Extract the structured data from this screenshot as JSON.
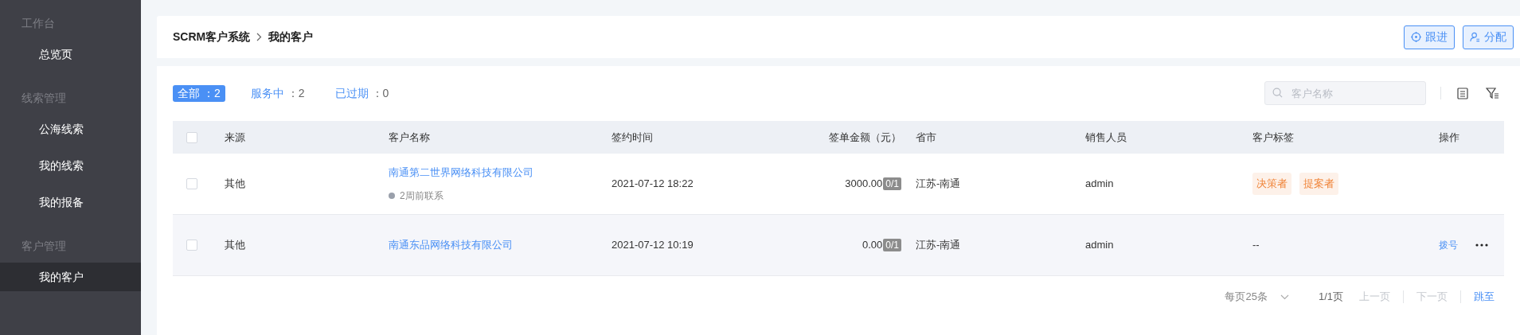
{
  "sidebar": {
    "groups": [
      {
        "title": "工作台",
        "items": [
          {
            "label": "总览页",
            "selected": false
          }
        ]
      },
      {
        "title": "线索管理",
        "items": [
          {
            "label": "公海线索",
            "selected": false
          },
          {
            "label": "我的线索",
            "selected": false
          },
          {
            "label": "我的报备",
            "selected": false
          }
        ]
      },
      {
        "title": "客户管理",
        "items": [
          {
            "label": "我的客户",
            "selected": true
          }
        ]
      }
    ]
  },
  "breadcrumb": [
    "SCRM客户系统",
    "我的客户"
  ],
  "header_buttons": [
    {
      "kind": "follow",
      "label": "跟进"
    },
    {
      "kind": "assign",
      "label": "分配"
    }
  ],
  "filter_tabs": [
    {
      "label": "全部",
      "count": "：2",
      "selected": true
    },
    {
      "label": "服务中",
      "count": "：2",
      "selected": false
    },
    {
      "label": "已过期",
      "count": "：0",
      "selected": false
    }
  ],
  "search": {
    "placeholder": "客户名称"
  },
  "table": {
    "all_checked": false,
    "columns": [
      "来源",
      "客户名称",
      "签约时间",
      "签单金额（元）",
      "省市",
      "销售人员",
      "客户标签",
      "操作"
    ],
    "rows": [
      {
        "checked": false,
        "source": "其他",
        "name": "南通第二世界网络科技有限公司",
        "contact": "2周前联系",
        "time": "2021-07-12 18:22",
        "amount": "3000.00",
        "ratio": "0/1",
        "region": "江苏-南通",
        "sales": "admin",
        "tags": [
          "决策者",
          "提案者"
        ],
        "actions": []
      },
      {
        "checked": false,
        "source": "其他",
        "name": "南通东品网络科技有限公司",
        "time": "2021-07-12 10:19",
        "amount": "0.00",
        "ratio": "0/1",
        "region": "江苏-南通",
        "sales": "admin",
        "tags_empty": "--",
        "actions": [
          "拨号"
        ],
        "more": true
      }
    ]
  },
  "pagination": {
    "page_size": "每页25条",
    "page": "1/1页",
    "prev": "上一页",
    "next": "下一页",
    "jump": "跳至"
  }
}
